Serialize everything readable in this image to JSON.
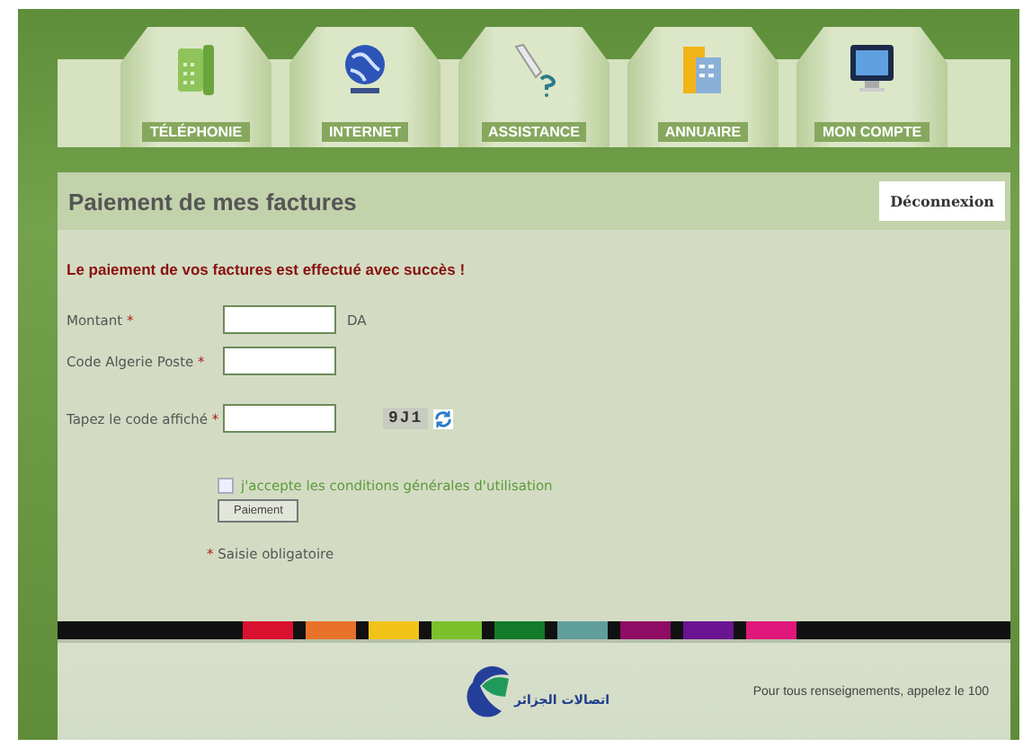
{
  "nav": [
    {
      "label": "TÉLÉPHONIE"
    },
    {
      "label": "INTERNET"
    },
    {
      "label": "ASSISTANCE"
    },
    {
      "label": "ANNUAIRE"
    },
    {
      "label": "MON COMPTE"
    }
  ],
  "page_title": "Paiement de mes factures",
  "logout_button": "Déconnexion",
  "message": "Le paiement de vos factures est effectué avec succès !",
  "form": {
    "fields": [
      {
        "kind": "text",
        "label": "Montant",
        "required_mark": "*",
        "unit": "DA"
      },
      {
        "kind": "text",
        "label": "Code Algerie Poste",
        "required_mark": "*"
      },
      {
        "kind": "captcha",
        "label": "Tapez le code affiché",
        "required_mark": "*",
        "captcha": "9J1"
      }
    ],
    "terms": {
      "label": "j'accepte les conditions générales d'utilisation",
      "checked": false
    },
    "submit": "Paiement",
    "required_note": {
      "mark": "*",
      "text": "Saisie obligatoire"
    }
  },
  "footer": {
    "stripe": [
      {
        "color": "#d9102e"
      },
      {
        "color": "#e8722a"
      },
      {
        "color": "#f2c418"
      },
      {
        "color": "#7cc02c"
      },
      {
        "color": "#137a2a"
      },
      {
        "color": "#5f9e9a"
      },
      {
        "color": "#8e0c63"
      },
      {
        "color": "#6a1491"
      },
      {
        "color": "#e0177a"
      }
    ],
    "logo_text": "اتصالات الجزائر",
    "contact": "Pour tous renseignements, appelez le 100"
  }
}
